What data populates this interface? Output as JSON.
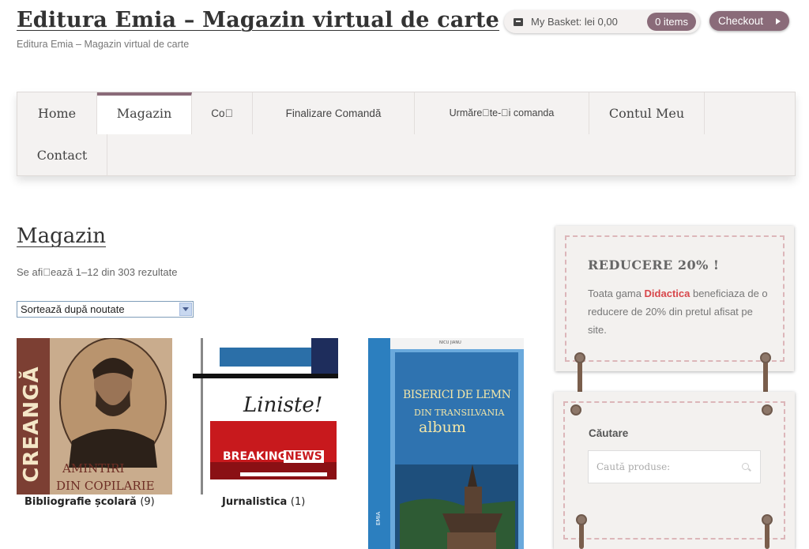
{
  "header": {
    "site_title": "Editura Emia – Magazin virtual de carte",
    "site_description": "Editura Emia – Magazin virtual de carte",
    "basket_label": "My Basket: lei 0,00",
    "items_badge": "0 items",
    "checkout_label": "Checkout"
  },
  "nav": {
    "items": [
      {
        "label": "Home"
      },
      {
        "label": "Magazin"
      },
      {
        "label": "Co\u0000"
      },
      {
        "label": "Finalizare Comandă"
      },
      {
        "label": "Urmăre\u0000te-\u0000i comanda"
      },
      {
        "label": "Contul Meu"
      },
      {
        "label": "Contact"
      }
    ]
  },
  "main": {
    "title": "Magazin",
    "results_text": "Se afi\u0000ează 1–12 din 303 rezultate",
    "sort_selected": "Sortează după noutate",
    "categories": [
      {
        "name": "Bibliografie școlară",
        "count": "(9)"
      },
      {
        "name": "Jurnalistica",
        "count": "(1)"
      }
    ],
    "covers": {
      "creanga_title": "CREANGĂ",
      "creanga_sub1": "AMINTIRI",
      "creanga_sub2": "DIN COPILARIE",
      "liniste": "Liniste!",
      "breaking": "BREAKING",
      "news": "NEWS",
      "biserici_author": "NICU JIANU",
      "biserici_line1": "BISERICI DE LEMN",
      "biserici_line2": "DIN TRANSILVANIA",
      "biserici_line3": "album",
      "biserici_publisher": "EMIA"
    }
  },
  "sidebar": {
    "promo_title": "REDUCERE 20% !",
    "promo_text_before": "Toata gama ",
    "promo_highlight": "Didactica",
    "promo_text_after": " beneficiaza de o reducere de 20% din pretul afisat pe site.",
    "search_heading": "Căutare",
    "search_placeholder": "Caută produse:"
  },
  "colors": {
    "accent": "#8a6b79",
    "highlight": "#d8474b",
    "nav_bg": "#f4f2f1"
  }
}
